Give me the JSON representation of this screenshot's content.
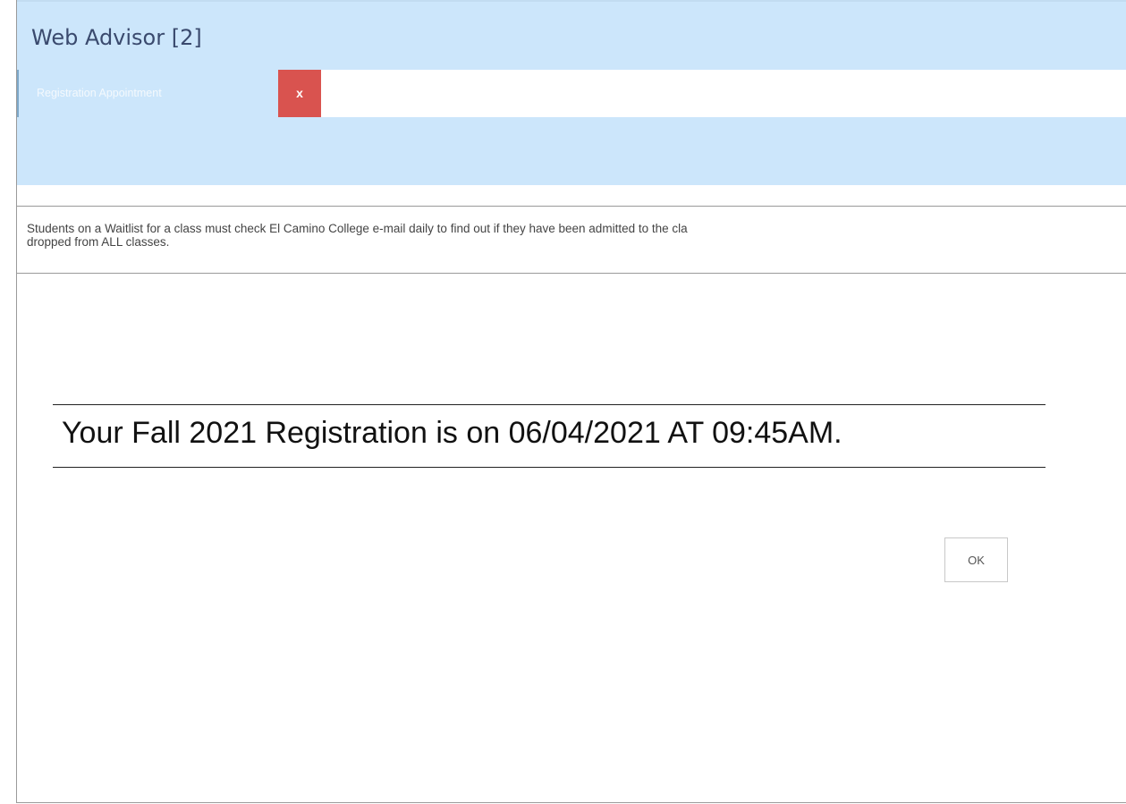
{
  "window": {
    "title": "Web Advisor [2]"
  },
  "tabs": [
    {
      "label": "Registration Appointment",
      "close_label": "x"
    }
  ],
  "notice": {
    "text": "Students on a Waitlist for a class must check El Camino College e-mail daily to find out if they have been admitted to the cla\ndropped from ALL classes."
  },
  "registration": {
    "message": "Your Fall 2021 Registration is on 06/04/2021 AT 09:45AM."
  },
  "actions": {
    "ok_label": "OK"
  },
  "colors": {
    "header_bg": "#cce6fb",
    "title_text": "#3a4a6e",
    "close_button": "#d9534f"
  }
}
